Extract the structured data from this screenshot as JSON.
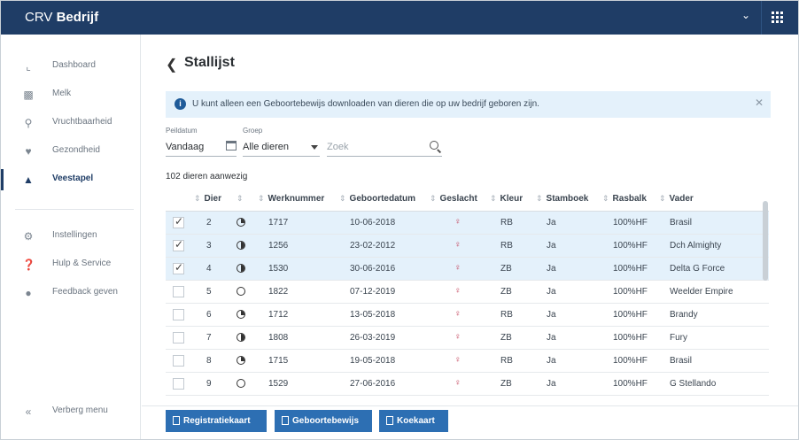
{
  "app": {
    "brand_prefix": "CRV",
    "brand_name": "Bedrijf"
  },
  "sidebar": {
    "items": [
      {
        "label": "Dashboard",
        "icon": "chart-icon"
      },
      {
        "label": "Melk",
        "icon": "milk-icon"
      },
      {
        "label": "Vruchtbaarheid",
        "icon": "fertility-icon"
      },
      {
        "label": "Gezondheid",
        "icon": "heart-icon"
      },
      {
        "label": "Veestapel",
        "icon": "cow-icon",
        "active": true
      },
      {
        "label": "Instellingen",
        "icon": "gear-icon"
      },
      {
        "label": "Hulp & Service",
        "icon": "help-icon"
      },
      {
        "label": "Feedback geven",
        "icon": "chat-icon"
      }
    ],
    "hide_label": "Verberg menu"
  },
  "page": {
    "title": "Stallijst"
  },
  "info": {
    "text": "U kunt alleen een Geboortebewijs downloaden van dieren die op uw bedrijf geboren zijn."
  },
  "filters": {
    "peildatum_label": "Peildatum",
    "peildatum_value": "Vandaag",
    "groep_label": "Groep",
    "groep_value": "Alle dieren",
    "search_placeholder": "Zoek"
  },
  "count_text": "102 dieren aanwezig",
  "table": {
    "columns": [
      "Dier",
      "Werknummer",
      "Geboortedatum",
      "Geslacht",
      "Kleur",
      "Stamboek",
      "Rasbalk",
      "Vader"
    ],
    "rows": [
      {
        "selected": true,
        "dier": "2",
        "status": "quarter",
        "werknummer": "1717",
        "geboortedatum": "10-06-2018",
        "kleur": "RB",
        "stamboek": "Ja",
        "rasbalk": "100%HF",
        "vader": "Brasil"
      },
      {
        "selected": true,
        "dier": "3",
        "status": "half",
        "werknummer": "1256",
        "geboortedatum": "23-02-2012",
        "kleur": "RB",
        "stamboek": "Ja",
        "rasbalk": "100%HF",
        "vader": "Dch Almighty"
      },
      {
        "selected": true,
        "dier": "4",
        "status": "half",
        "werknummer": "1530",
        "geboortedatum": "30-06-2016",
        "kleur": "ZB",
        "stamboek": "Ja",
        "rasbalk": "100%HF",
        "vader": "Delta G Force"
      },
      {
        "selected": false,
        "dier": "5",
        "status": "empty",
        "werknummer": "1822",
        "geboortedatum": "07-12-2019",
        "kleur": "ZB",
        "stamboek": "Ja",
        "rasbalk": "100%HF",
        "vader": "Weelder Empire"
      },
      {
        "selected": false,
        "dier": "6",
        "status": "quarter",
        "werknummer": "1712",
        "geboortedatum": "13-05-2018",
        "kleur": "RB",
        "stamboek": "Ja",
        "rasbalk": "100%HF",
        "vader": "Brandy"
      },
      {
        "selected": false,
        "dier": "7",
        "status": "half",
        "werknummer": "1808",
        "geboortedatum": "26-03-2019",
        "kleur": "ZB",
        "stamboek": "Ja",
        "rasbalk": "100%HF",
        "vader": "Fury"
      },
      {
        "selected": false,
        "dier": "8",
        "status": "quarter",
        "werknummer": "1715",
        "geboortedatum": "19-05-2018",
        "kleur": "RB",
        "stamboek": "Ja",
        "rasbalk": "100%HF",
        "vader": "Brasil"
      },
      {
        "selected": false,
        "dier": "9",
        "status": "empty",
        "werknummer": "1529",
        "geboortedatum": "27-06-2016",
        "kleur": "ZB",
        "stamboek": "Ja",
        "rasbalk": "100%HF",
        "vader": "G Stellando"
      }
    ]
  },
  "actions": {
    "registratiekaart": "Registratiekaart",
    "geboortebewijs": "Geboortebewijs",
    "koekaart": "Koekaart"
  },
  "colors": {
    "primary": "#1f3d66",
    "button": "#2d6fb3",
    "selected_row": "#e4f1fb",
    "female": "#c03a54"
  }
}
